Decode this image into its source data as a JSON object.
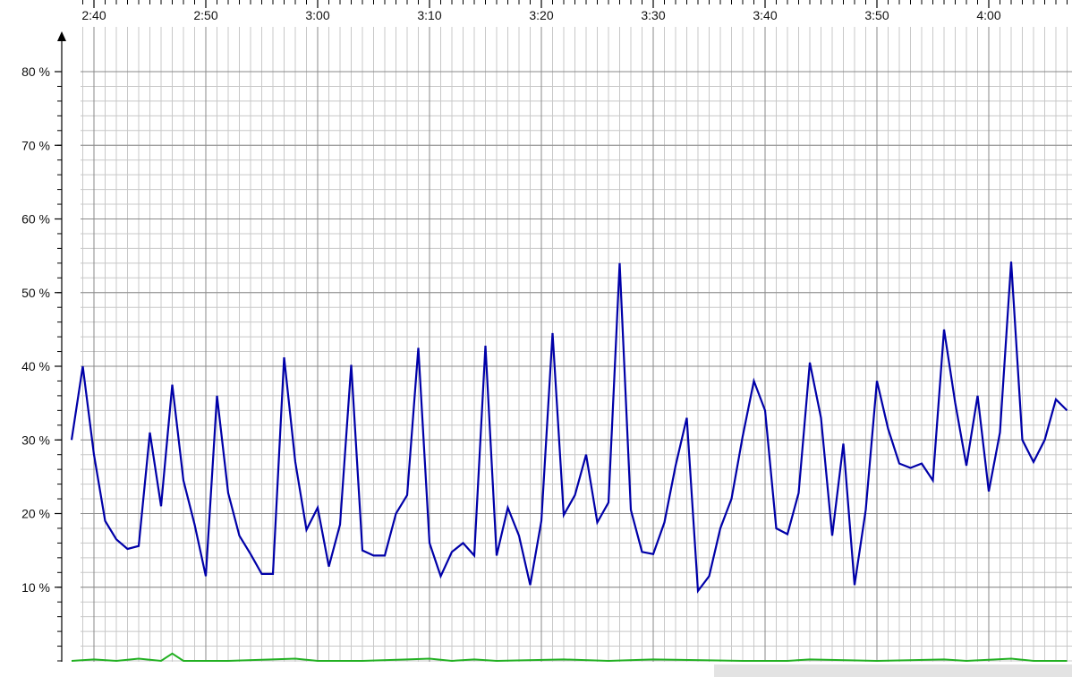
{
  "chart_data": {
    "type": "line",
    "title": "",
    "xlabel": "",
    "ylabel": "",
    "x_tick_labels": [
      "2:40",
      "2:50",
      "3:00",
      "3:10",
      "3:20",
      "3:30",
      "3:40",
      "3:50",
      "4:00"
    ],
    "x_tick_times": [
      "2:40",
      "2:50",
      "3:00",
      "3:10",
      "3:20",
      "3:30",
      "3:40",
      "3:50",
      "4:00"
    ],
    "xlim": [
      "2:38",
      "4:07"
    ],
    "y_tick_labels": [
      "10 %",
      "20 %",
      "30 %",
      "40 %",
      "50 %",
      "60 %",
      "70 %",
      "80 %"
    ],
    "y_tick_values": [
      10,
      20,
      30,
      40,
      50,
      60,
      70,
      80
    ],
    "ylim": [
      0,
      80
    ],
    "grid": true,
    "series": [
      {
        "color": "#0000a8",
        "x": [
          "2:38",
          "2:39",
          "2:40",
          "2:41",
          "2:42",
          "2:43",
          "2:44",
          "2:45",
          "2:46",
          "2:47",
          "2:48",
          "2:49",
          "2:50",
          "2:51",
          "2:52",
          "2:53",
          "2:54",
          "2:55",
          "2:56",
          "2:57",
          "2:58",
          "2:59",
          "3:00",
          "3:01",
          "3:02",
          "3:03",
          "3:04",
          "3:05",
          "3:06",
          "3:07",
          "3:08",
          "3:09",
          "3:10",
          "3:11",
          "3:12",
          "3:13",
          "3:14",
          "3:15",
          "3:16",
          "3:17",
          "3:18",
          "3:19",
          "3:20",
          "3:21",
          "3:22",
          "3:23",
          "3:24",
          "3:25",
          "3:26",
          "3:27",
          "3:28",
          "3:29",
          "3:30",
          "3:31",
          "3:32",
          "3:33",
          "3:34",
          "3:35",
          "3:36",
          "3:37",
          "3:38",
          "3:39",
          "3:40",
          "3:41",
          "3:42",
          "3:43",
          "3:44",
          "3:45",
          "3:46",
          "3:47",
          "3:48",
          "3:49",
          "3:50",
          "3:51",
          "3:52",
          "3:53",
          "3:54",
          "3:55",
          "3:56",
          "3:57",
          "3:58",
          "3:59",
          "4:00",
          "4:01",
          "4:02",
          "4:03",
          "4:04",
          "4:05",
          "4:06",
          "4:07"
        ],
        "values": [
          30,
          40,
          28,
          19,
          16.5,
          15.2,
          15.6,
          31,
          21,
          37.5,
          24.5,
          18.5,
          11.5,
          36,
          22.8,
          17,
          14.5,
          11.8,
          11.8,
          41.2,
          27,
          17.8,
          20.8,
          12.8,
          18.5,
          40.2,
          15,
          14.3,
          14.3,
          20,
          22.5,
          42.5,
          16,
          11.5,
          14.8,
          16,
          14.3,
          42.8,
          14.3,
          20.8,
          17,
          10.3,
          19,
          44.5,
          19.8,
          22.5,
          28,
          18.8,
          21.5,
          54,
          20.5,
          14.8,
          14.5,
          18.8,
          26.5,
          33,
          9.5,
          11.5,
          18,
          22,
          30.5,
          38,
          34,
          18,
          17.2,
          22.8,
          40.5,
          33,
          17,
          29.5,
          10.3,
          20.5,
          38,
          31.5,
          26.8,
          26.2,
          26.8,
          24.5,
          45,
          35,
          26.5,
          36,
          23,
          31,
          54.2,
          30,
          27,
          30,
          35.5,
          34
        ]
      },
      {
        "color": "#22b022",
        "x": [
          "2:38",
          "2:40",
          "2:42",
          "2:44",
          "2:46",
          "2:47",
          "2:48",
          "2:52",
          "2:58",
          "3:00",
          "3:04",
          "3:08",
          "3:10",
          "3:12",
          "3:14",
          "3:16",
          "3:22",
          "3:26",
          "3:30",
          "3:38",
          "3:42",
          "3:44",
          "3:50",
          "3:56",
          "3:58",
          "4:02",
          "4:04",
          "4:07"
        ],
        "values": [
          0,
          0.2,
          0,
          0.3,
          0,
          1,
          0,
          0,
          0.3,
          0,
          0,
          0.2,
          0.3,
          0,
          0.2,
          0,
          0.2,
          0,
          0.2,
          0,
          0,
          0.2,
          0,
          0.2,
          0,
          0.3,
          0,
          0
        ]
      }
    ]
  }
}
